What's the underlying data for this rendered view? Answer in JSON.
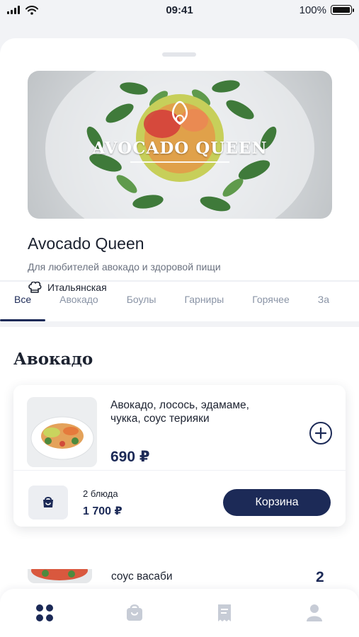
{
  "status_bar": {
    "time": "09:41",
    "battery": "100%",
    "battery_level": 1.0
  },
  "restaurant": {
    "hero_logo": "AVOCADO QUEEN",
    "name": "Avocado Queen",
    "description": "Для любителей авокадо и здоровой пищи",
    "cuisine": "Итальянская"
  },
  "tabs": [
    {
      "label": "Все",
      "active": true
    },
    {
      "label": "Авокадо",
      "active": false
    },
    {
      "label": "Боулы",
      "active": false
    },
    {
      "label": "Гарниры",
      "active": false
    },
    {
      "label": "Горячее",
      "active": false
    },
    {
      "label": "За",
      "active": false
    }
  ],
  "section": {
    "title": "Авокадо"
  },
  "dish": {
    "name": "Авокадо, лосось, эдамаме, чукка, соус терияки",
    "price": "690 ₽"
  },
  "cart": {
    "count_label": "2 блюда",
    "total": "1 700 ₽",
    "button_label": "Корзина"
  },
  "next_dish": {
    "name": "соус васаби",
    "quantity": "2"
  },
  "bottom_nav": [
    {
      "icon": "grid-icon",
      "active": true
    },
    {
      "icon": "bag-icon",
      "active": false
    },
    {
      "icon": "receipt-icon",
      "active": false
    },
    {
      "icon": "user-icon",
      "active": false
    }
  ],
  "colors": {
    "accent": "#1c2a57",
    "muted": "#8a94a6"
  }
}
